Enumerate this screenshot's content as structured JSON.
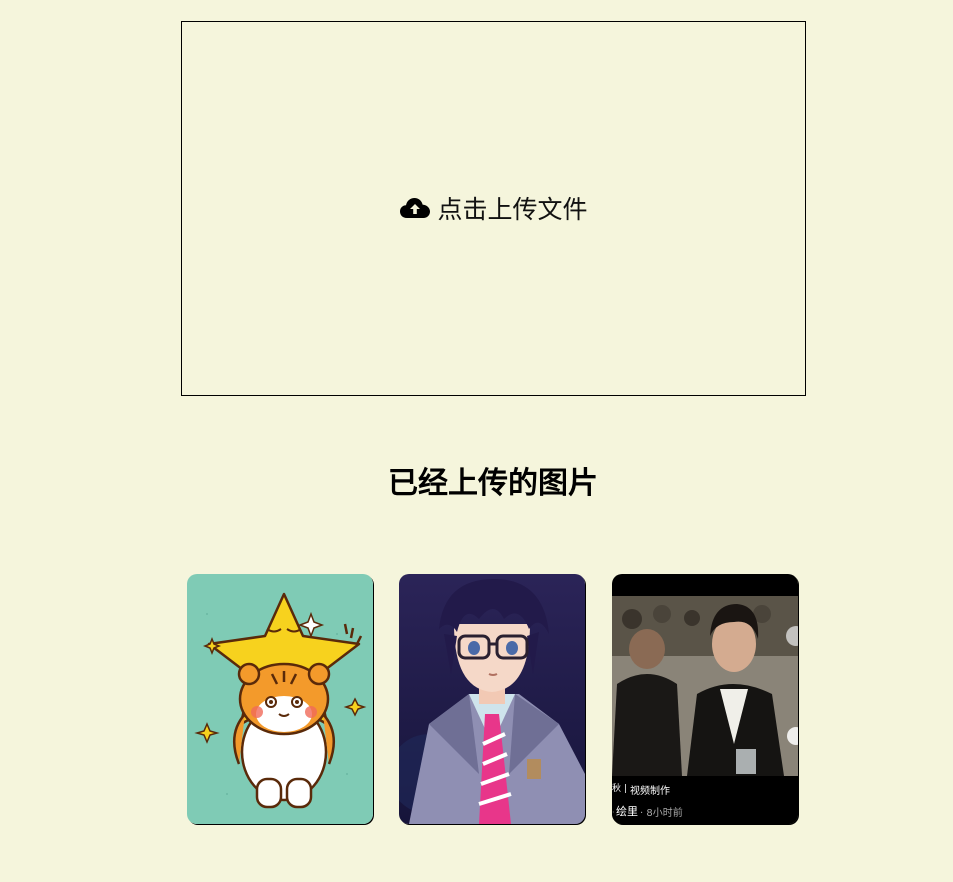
{
  "upload": {
    "label": "点击上传文件",
    "icon": "cloud-upload-icon"
  },
  "gallery": {
    "title": "已经上传的图片",
    "images": [
      {
        "name": "tiger-star-sticker"
      },
      {
        "name": "anime-boy-glasses"
      },
      {
        "name": "video-screenshot",
        "caption_tags": "视频制作",
        "caption_author": "绘里",
        "caption_time": "· 8小时前"
      }
    ]
  }
}
